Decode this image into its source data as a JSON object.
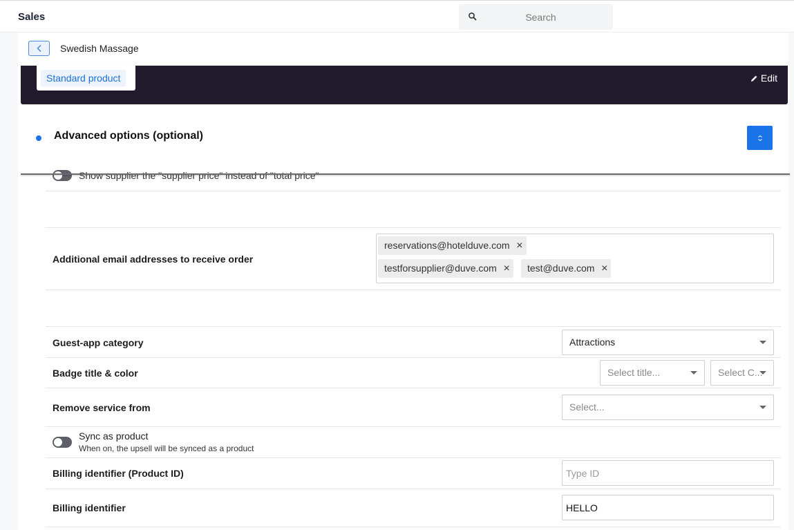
{
  "topbar": {
    "title": "Sales",
    "search_placeholder": "Search"
  },
  "subheader": {
    "title": "Swedish Massage"
  },
  "banner": {
    "chip_label": "Standard product",
    "edit_label": "Edit"
  },
  "section": {
    "title": "Advanced options (optional)"
  },
  "supplier_price": {
    "label": "Show supplier the \"supplier price\" instead of \"total price\""
  },
  "emails": {
    "label": "Additional email addresses to receive order",
    "tags": [
      "reservations@hotelduve.com",
      "testforsupplier@duve.com",
      "test@duve.com"
    ]
  },
  "guest_app": {
    "label": "Guest-app category",
    "value": "Attractions"
  },
  "badge": {
    "label": "Badge title & color",
    "title_placeholder": "Select title...",
    "color_placeholder": "Select C..."
  },
  "remove_service": {
    "label": "Remove service from",
    "placeholder": "Select..."
  },
  "sync": {
    "title": "Sync as product",
    "subtitle": "When on, the upsell will be synced as a product"
  },
  "billing_product_id": {
    "label": "Billing identifier (Product ID)",
    "placeholder": "Type ID"
  },
  "billing_identifier": {
    "label": "Billing identifier",
    "value": "HELLO"
  }
}
